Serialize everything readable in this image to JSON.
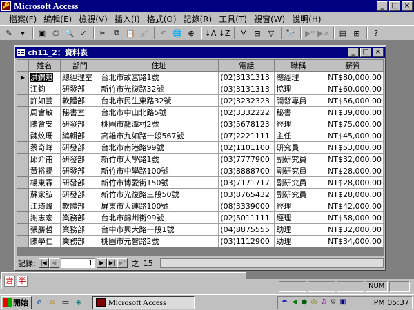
{
  "app": {
    "title": "Microsoft Access"
  },
  "menu": [
    "檔案(F)",
    "編輯(E)",
    "檢視(V)",
    "插入(I)",
    "格式(O)",
    "記錄(R)",
    "工具(T)",
    "視窗(W)",
    "說明(H)"
  ],
  "toolbar_icons": [
    "design-view-icon",
    "save-icon",
    "print-icon",
    "print-preview-icon",
    "spelling-icon",
    "cut-icon",
    "copy-icon",
    "paste-icon",
    "format-painter-icon",
    "undo-icon",
    "insert-hyperlink-icon",
    "web-toolbar-icon",
    "sort-ascending-icon",
    "sort-descending-icon",
    "filter-by-selection-icon",
    "filter-by-form-icon",
    "apply-filter-icon",
    "find-icon",
    "new-record-icon",
    "delete-record-icon",
    "database-window-icon",
    "new-object-icon",
    "help-icon"
  ],
  "datasheet": {
    "title": "ch11_2：資料表",
    "columns": [
      "姓名",
      "部門",
      "住址",
      "電話",
      "職稱",
      "薪資"
    ],
    "rows": [
      [
        "洪錦魁",
        "總經理室",
        "台北市故宮路1號",
        "(02)3131313",
        "總經理",
        "NT$80,000.00"
      ],
      [
        "江鈞",
        "研發部",
        "新竹市光復路32號",
        "(03)3131313",
        "協理",
        "NT$60,000.00"
      ],
      [
        "許如芸",
        "軟體部",
        "台北市民生東路32號",
        "(02)3232323",
        "開發專員",
        "NT$56,000.00"
      ],
      [
        "周會敏",
        "秘書室",
        "台北市中山北路5號",
        "(02)3332222",
        "秘書",
        "NT$39,000.00"
      ],
      [
        "陳會安",
        "研發部",
        "桃園市龍潭村2號",
        "(03)5678123",
        "經理",
        "NT$75,000.00"
      ],
      [
        "魏炆珊",
        "編輯部",
        "高雄市九如路一段567號",
        "(07)2221111",
        "主任",
        "NT$45,000.00"
      ],
      [
        "蔡奇峰",
        "研發部",
        "台北市南港路99號",
        "(02)1101100",
        "研究員",
        "NT$53,000.00"
      ],
      [
        "邱介甫",
        "研發部",
        "新竹市大學路1號",
        "(03)7777900",
        "副研究員",
        "NT$32,000.00"
      ],
      [
        "黃裕揚",
        "研發部",
        "新竹市中學路100號",
        "(03)8888700",
        "副研究員",
        "NT$28,000.00"
      ],
      [
        "楊東霖",
        "研發部",
        "新竹市博愛街150號",
        "(03)7171717",
        "副研究員",
        "NT$28,000.00"
      ],
      [
        "蘇家弘",
        "研發部",
        "新竹市光復路三段50號",
        "(03)8765432",
        "副研究員",
        "NT$28,000.00"
      ],
      [
        "江琦峰",
        "軟體部",
        "屏東市大連路100號",
        "(08)3339000",
        "經理",
        "NT$42,000.00"
      ],
      [
        "謝志宏",
        "業務部",
        "台北市錦州街99號",
        "(02)5011111",
        "經理",
        "NT$58,000.00"
      ],
      [
        "張勝哲",
        "業務部",
        "台中市興大路一段1號",
        "(04)8875555",
        "助理",
        "NT$32,000.00"
      ],
      [
        "陳學仁",
        "業務部",
        "桃園市元智路2號",
        "(03)1112900",
        "助理",
        "NT$34,000.00"
      ]
    ],
    "nav": {
      "label": "記錄:",
      "current": "1",
      "of": "之",
      "total": "15"
    }
  },
  "ime": {
    "method": "倉",
    "mode": "半"
  },
  "status": {
    "num": "NUM"
  },
  "taskbar": {
    "start": "開始",
    "task": "Microsoft Access",
    "clock": "PM 05:37",
    "tray_icons": [
      "pen-icon",
      "volume-icon",
      "network-icon",
      "chat-icon",
      "speaker-icon",
      "settings-icon"
    ]
  },
  "colors": {
    "titlebar": "#000080",
    "face": "#c0c0c0",
    "workspace": "#808080"
  }
}
